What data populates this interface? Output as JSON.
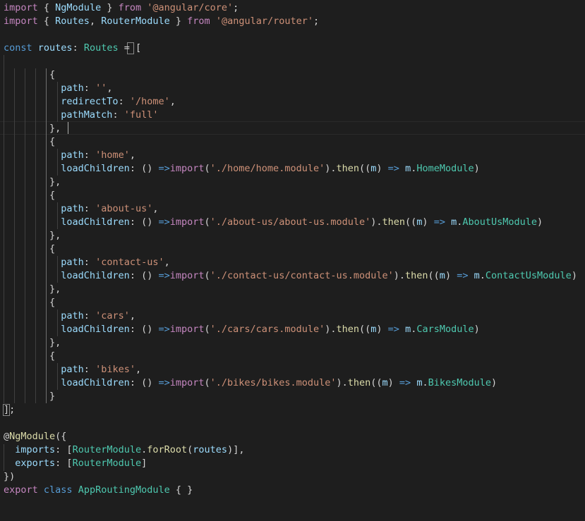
{
  "editor": {
    "language": "typescript",
    "theme": "dark",
    "cursor": {
      "line": 10,
      "column": 7
    },
    "lines": [
      [
        [
          "import",
          "kw"
        ],
        [
          " { ",
          "pn"
        ],
        [
          "NgModule",
          "vr"
        ],
        [
          " } ",
          "pn"
        ],
        [
          "from",
          "kw"
        ],
        [
          " ",
          "pn"
        ],
        [
          "'@angular/core'",
          "s"
        ],
        [
          ";",
          "pn"
        ]
      ],
      [
        [
          "import",
          "kw"
        ],
        [
          " { ",
          "pn"
        ],
        [
          "Routes",
          "vr"
        ],
        [
          ", ",
          "pn"
        ],
        [
          "RouterModule",
          "vr"
        ],
        [
          " } ",
          "pn"
        ],
        [
          "from",
          "kw"
        ],
        [
          " ",
          "pn"
        ],
        [
          "'@angular/router'",
          "s"
        ],
        [
          ";",
          "pn"
        ]
      ],
      [],
      [
        [
          "const",
          "st"
        ],
        [
          " ",
          "pn"
        ],
        [
          "routes",
          "vr"
        ],
        [
          ": ",
          "pn"
        ],
        [
          "Routes",
          "ty"
        ],
        [
          " = ",
          "pn"
        ],
        [
          "[",
          "pn"
        ]
      ],
      [],
      [
        [
          "        {",
          "pn"
        ]
      ],
      [
        [
          "          ",
          "pn"
        ],
        [
          "path",
          "vr"
        ],
        [
          ": ",
          "pn"
        ],
        [
          "''",
          "s"
        ],
        [
          ",",
          "pn"
        ]
      ],
      [
        [
          "          ",
          "pn"
        ],
        [
          "redirectTo",
          "vr"
        ],
        [
          ": ",
          "pn"
        ],
        [
          "'/home'",
          "s"
        ],
        [
          ",",
          "pn"
        ]
      ],
      [
        [
          "          ",
          "pn"
        ],
        [
          "pathMatch",
          "vr"
        ],
        [
          ": ",
          "pn"
        ],
        [
          "'full'",
          "s"
        ]
      ],
      [
        [
          "        },",
          "pn"
        ]
      ],
      [
        [
          "        {",
          "pn"
        ]
      ],
      [
        [
          "          ",
          "pn"
        ],
        [
          "path",
          "vr"
        ],
        [
          ": ",
          "pn"
        ],
        [
          "'home'",
          "s"
        ],
        [
          ",",
          "pn"
        ]
      ],
      [
        [
          "          ",
          "pn"
        ],
        [
          "loadChildren",
          "vr"
        ],
        [
          ": () ",
          "pn"
        ],
        [
          "=>",
          "st"
        ],
        [
          "import",
          "kw"
        ],
        [
          "(",
          "pn"
        ],
        [
          "'./home/home.module'",
          "s"
        ],
        [
          ").",
          "pn"
        ],
        [
          "then",
          "fn"
        ],
        [
          "((",
          "pn"
        ],
        [
          "m",
          "vr"
        ],
        [
          ") ",
          "pn"
        ],
        [
          "=>",
          "st"
        ],
        [
          " ",
          "pn"
        ],
        [
          "m",
          "vr"
        ],
        [
          ".",
          "pn"
        ],
        [
          "HomeModule",
          "ty"
        ],
        [
          ")",
          "pn"
        ]
      ],
      [
        [
          "        },",
          "pn"
        ]
      ],
      [
        [
          "        {",
          "pn"
        ]
      ],
      [
        [
          "          ",
          "pn"
        ],
        [
          "path",
          "vr"
        ],
        [
          ": ",
          "pn"
        ],
        [
          "'about-us'",
          "s"
        ],
        [
          ",",
          "pn"
        ]
      ],
      [
        [
          "          ",
          "pn"
        ],
        [
          "loadChildren",
          "vr"
        ],
        [
          ": () ",
          "pn"
        ],
        [
          "=>",
          "st"
        ],
        [
          "import",
          "kw"
        ],
        [
          "(",
          "pn"
        ],
        [
          "'./about-us/about-us.module'",
          "s"
        ],
        [
          ").",
          "pn"
        ],
        [
          "then",
          "fn"
        ],
        [
          "((",
          "pn"
        ],
        [
          "m",
          "vr"
        ],
        [
          ") ",
          "pn"
        ],
        [
          "=>",
          "st"
        ],
        [
          " ",
          "pn"
        ],
        [
          "m",
          "vr"
        ],
        [
          ".",
          "pn"
        ],
        [
          "AboutUsModule",
          "ty"
        ],
        [
          ")",
          "pn"
        ]
      ],
      [
        [
          "        },",
          "pn"
        ]
      ],
      [
        [
          "        {",
          "pn"
        ]
      ],
      [
        [
          "          ",
          "pn"
        ],
        [
          "path",
          "vr"
        ],
        [
          ": ",
          "pn"
        ],
        [
          "'contact-us'",
          "s"
        ],
        [
          ",",
          "pn"
        ]
      ],
      [
        [
          "          ",
          "pn"
        ],
        [
          "loadChildren",
          "vr"
        ],
        [
          ": () ",
          "pn"
        ],
        [
          "=>",
          "st"
        ],
        [
          "import",
          "kw"
        ],
        [
          "(",
          "pn"
        ],
        [
          "'./contact-us/contact-us.module'",
          "s"
        ],
        [
          ").",
          "pn"
        ],
        [
          "then",
          "fn"
        ],
        [
          "((",
          "pn"
        ],
        [
          "m",
          "vr"
        ],
        [
          ") ",
          "pn"
        ],
        [
          "=>",
          "st"
        ],
        [
          " ",
          "pn"
        ],
        [
          "m",
          "vr"
        ],
        [
          ".",
          "pn"
        ],
        [
          "ContactUsModule",
          "ty"
        ],
        [
          ")",
          "pn"
        ]
      ],
      [
        [
          "        },",
          "pn"
        ]
      ],
      [
        [
          "        {",
          "pn"
        ]
      ],
      [
        [
          "          ",
          "pn"
        ],
        [
          "path",
          "vr"
        ],
        [
          ": ",
          "pn"
        ],
        [
          "'cars'",
          "s"
        ],
        [
          ",",
          "pn"
        ]
      ],
      [
        [
          "          ",
          "pn"
        ],
        [
          "loadChildren",
          "vr"
        ],
        [
          ": () ",
          "pn"
        ],
        [
          "=>",
          "st"
        ],
        [
          "import",
          "kw"
        ],
        [
          "(",
          "pn"
        ],
        [
          "'./cars/cars.module'",
          "s"
        ],
        [
          ").",
          "pn"
        ],
        [
          "then",
          "fn"
        ],
        [
          "((",
          "pn"
        ],
        [
          "m",
          "vr"
        ],
        [
          ") ",
          "pn"
        ],
        [
          "=>",
          "st"
        ],
        [
          " ",
          "pn"
        ],
        [
          "m",
          "vr"
        ],
        [
          ".",
          "pn"
        ],
        [
          "CarsModule",
          "ty"
        ],
        [
          ")",
          "pn"
        ]
      ],
      [
        [
          "        },",
          "pn"
        ]
      ],
      [
        [
          "        {",
          "pn"
        ]
      ],
      [
        [
          "          ",
          "pn"
        ],
        [
          "path",
          "vr"
        ],
        [
          ": ",
          "pn"
        ],
        [
          "'bikes'",
          "s"
        ],
        [
          ",",
          "pn"
        ]
      ],
      [
        [
          "          ",
          "pn"
        ],
        [
          "loadChildren",
          "vr"
        ],
        [
          ": () ",
          "pn"
        ],
        [
          "=>",
          "st"
        ],
        [
          "import",
          "kw"
        ],
        [
          "(",
          "pn"
        ],
        [
          "'./bikes/bikes.module'",
          "s"
        ],
        [
          ").",
          "pn"
        ],
        [
          "then",
          "fn"
        ],
        [
          "((",
          "pn"
        ],
        [
          "m",
          "vr"
        ],
        [
          ") ",
          "pn"
        ],
        [
          "=>",
          "st"
        ],
        [
          " ",
          "pn"
        ],
        [
          "m",
          "vr"
        ],
        [
          ".",
          "pn"
        ],
        [
          "BikesModule",
          "ty"
        ],
        [
          ")",
          "pn"
        ]
      ],
      [
        [
          "        }",
          "pn"
        ]
      ],
      [
        [
          "];",
          "pn"
        ]
      ],
      [],
      [
        [
          "@",
          "pn"
        ],
        [
          "NgModule",
          "fn"
        ],
        [
          "({",
          "pn"
        ]
      ],
      [
        [
          "  ",
          "pn"
        ],
        [
          "imports",
          "vr"
        ],
        [
          ": [",
          "pn"
        ],
        [
          "RouterModule",
          "ty"
        ],
        [
          ".",
          "pn"
        ],
        [
          "forRoot",
          "fn"
        ],
        [
          "(",
          "pn"
        ],
        [
          "routes",
          "vr"
        ],
        [
          ")],",
          "pn"
        ]
      ],
      [
        [
          "  ",
          "pn"
        ],
        [
          "exports",
          "vr"
        ],
        [
          ": [",
          "pn"
        ],
        [
          "RouterModule",
          "ty"
        ],
        [
          "]",
          "pn"
        ]
      ],
      [
        [
          "})",
          "pn"
        ]
      ],
      [
        [
          "export",
          "kw"
        ],
        [
          " ",
          "pn"
        ],
        [
          "class",
          "st"
        ],
        [
          " ",
          "pn"
        ],
        [
          "AppRoutingModule",
          "ty"
        ],
        [
          " { }",
          "pn"
        ]
      ]
    ]
  }
}
